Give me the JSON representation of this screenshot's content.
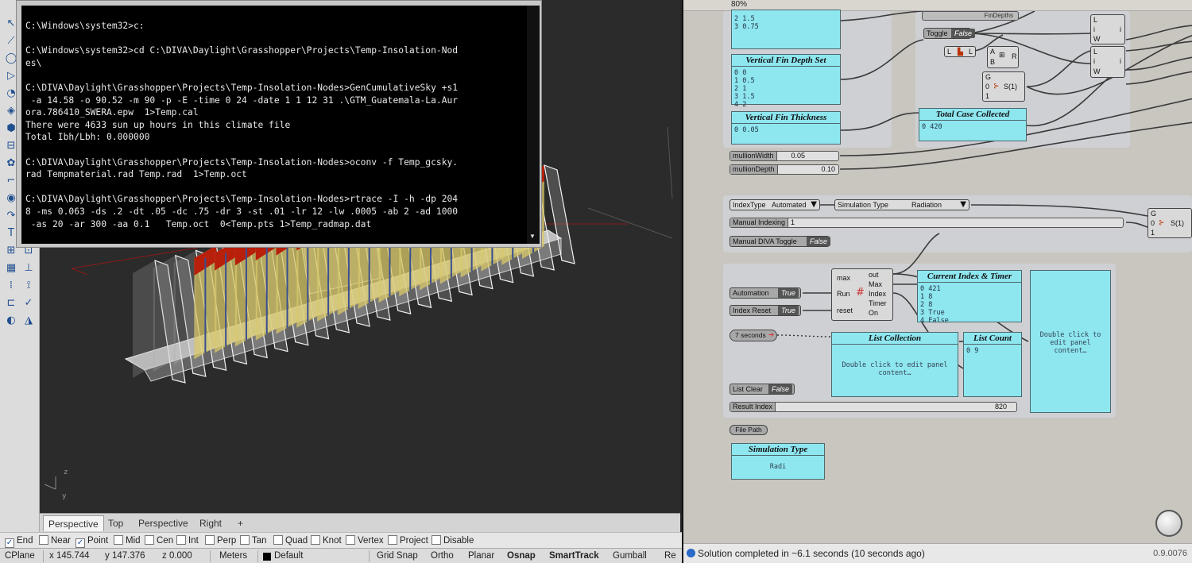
{
  "terminal": {
    "lines": [
      "C:\\Windows\\system32>c:",
      "",
      "C:\\Windows\\system32>cd C:\\DIVA\\Daylight\\Grasshopper\\Projects\\Temp-Insolation-Nod",
      "es\\",
      "",
      "C:\\DIVA\\Daylight\\Grasshopper\\Projects\\Temp-Insolation-Nodes>GenCumulativeSky +s1",
      " -a 14.58 -o 90.52 -m 90 -p -E -time 0 24 -date 1 1 12 31 .\\GTM_Guatemala-La.Aur",
      "ora.786410_SWERA.epw  1>Temp.cal",
      "There were 4633 sun up hours in this climate file",
      "Total Ibh/Lbh: 0.000000",
      "",
      "C:\\DIVA\\Daylight\\Grasshopper\\Projects\\Temp-Insolation-Nodes>oconv -f Temp_gcsky.",
      "rad Tempmaterial.rad Temp.rad  1>Temp.oct",
      "",
      "C:\\DIVA\\Daylight\\Grasshopper\\Projects\\Temp-Insolation-Nodes>rtrace -I -h -dp 204",
      "8 -ms 0.063 -ds .2 -dt .05 -dc .75 -dr 3 -st .01 -lr 12 -lw .0005 -ab 2 -ad 1000",
      " -as 20 -ar 300 -aa 0.1   Temp.oct  0<Temp.pts 1>Temp_radmap.dat"
    ]
  },
  "viewport": {
    "axis_z": "z",
    "axis_y": "y",
    "tabs": [
      "Perspective",
      "Top",
      "Perspective",
      "Right"
    ],
    "add_tab": "+"
  },
  "osnap": [
    {
      "label": "End",
      "checked": true
    },
    {
      "label": "Near",
      "checked": false
    },
    {
      "label": "Point",
      "checked": true
    },
    {
      "label": "Mid",
      "checked": false
    },
    {
      "label": "Cen",
      "checked": false
    },
    {
      "label": "Int",
      "checked": false
    },
    {
      "label": "Perp",
      "checked": false
    },
    {
      "label": "Tan",
      "checked": false
    },
    {
      "label": "Quad",
      "checked": false
    },
    {
      "label": "Knot",
      "checked": false
    },
    {
      "label": "Vertex",
      "checked": false
    },
    {
      "label": "Project",
      "checked": false
    },
    {
      "label": "Disable",
      "checked": false
    }
  ],
  "statusbar": {
    "cplane": "CPlane",
    "x": "x 145.744",
    "y": "y 147.376",
    "z": "z 0.000",
    "units": "Meters",
    "layer": "Default",
    "grid_snap": "Grid Snap",
    "ortho": "Ortho",
    "planar": "Planar",
    "osnap": "Osnap",
    "smarttrack": "SmartTrack",
    "gumball": "Gumball",
    "record": "Re"
  },
  "gh": {
    "top_zoom": "80%",
    "vertical_fin_depth_set": {
      "title": "Vertical Fin Depth Set",
      "items": [
        "0 0",
        "1 0.5",
        "2 1",
        "3 1.5",
        "4 2"
      ]
    },
    "top_panel": {
      "items": [
        "2 1.5",
        "3 0.75"
      ]
    },
    "vertical_fin_thickness": {
      "title": "Vertical Fin Thickness",
      "items": [
        "0 0.05"
      ]
    },
    "total_case_collected": {
      "title": "Total Case Collected",
      "items": [
        "0 420"
      ]
    },
    "mullion_width": {
      "label": "mullionWidth",
      "value": "0.05"
    },
    "mullion_depth": {
      "label": "mullionDepth",
      "value": "0.10"
    },
    "toggle_top": {
      "label": "Toggle",
      "value": "False"
    },
    "fin_depths_label": "FinDepths",
    "index_type": {
      "label": "IndexType",
      "value": "Automated"
    },
    "simulation_type_dd": {
      "label": "Simulation Type",
      "value": "Radiation"
    },
    "manual_indexing": {
      "label": "Manual Indexing",
      "value": "1"
    },
    "manual_diva_toggle": {
      "label": "Manual DIVA Toggle",
      "value": "False"
    },
    "automation": {
      "label": "Automation",
      "value": "True"
    },
    "index_reset": {
      "label": "Index Reset",
      "value": "True"
    },
    "timer": {
      "label": "7 seconds"
    },
    "script_comp": {
      "inputs": [
        "max",
        "Run",
        "reset"
      ],
      "outputs": [
        "out",
        "Max",
        "Index",
        "Timer",
        "On"
      ]
    },
    "current_index_timer": {
      "title": "Current Index & Timer",
      "items": [
        "0 421",
        "1 8",
        "2 8",
        "3 True",
        "4 False"
      ]
    },
    "list_collection": {
      "title": "List Collection",
      "body": "Double click to edit panel content…"
    },
    "list_count": {
      "title": "List Count",
      "items": [
        "0 9"
      ]
    },
    "big_panel": {
      "body": "Double click to edit panel content…"
    },
    "list_clear": {
      "label": "List Clear",
      "value": "False"
    },
    "result_index": {
      "label": "Result Index",
      "value": "820"
    },
    "file_path": {
      "label": "File Path"
    },
    "simulation_type_panel": {
      "title": "Simulation Type",
      "body": "Radi"
    },
    "gate_ports": [
      "G",
      "0",
      "1"
    ],
    "gate_out": "S(1)",
    "gate_ports_right": [
      "G",
      "0",
      "1"
    ],
    "gate_out_right": "S(1)",
    "add_ports": [
      "A",
      "B"
    ],
    "add_out": "R",
    "list_ports": [
      "L"
    ],
    "list_item_ports": [
      "L",
      "i",
      "W"
    ],
    "list_item_out": "i"
  },
  "gh_status": {
    "message": "Solution completed in ~6.1 seconds (10 seconds ago)",
    "version": "0.9.0076"
  },
  "colors": {
    "terminal_bg": "#000000",
    "panel_cyan": "#8ee6ef",
    "gh_canvas": "#c8c6bf",
    "fin_red": "#b8200c",
    "fin_yellow": "#d8c86a"
  }
}
